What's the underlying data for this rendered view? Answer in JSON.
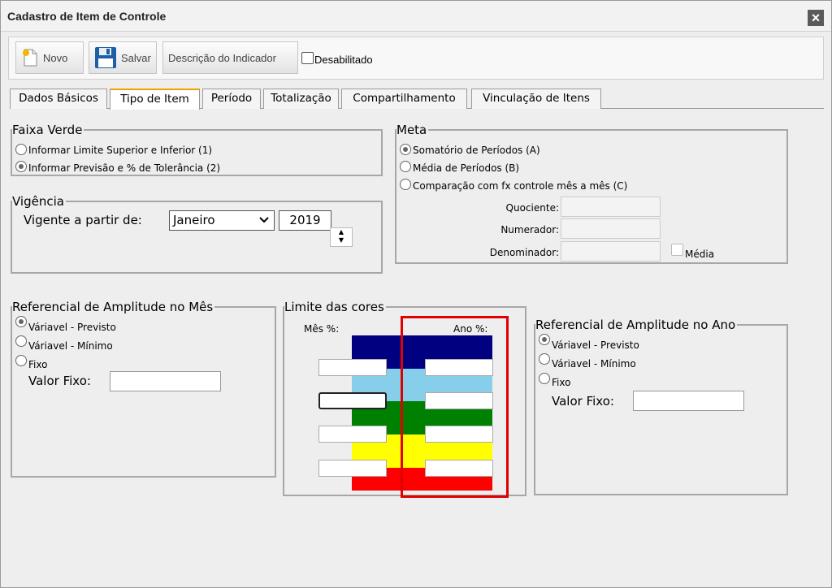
{
  "window": {
    "title": "Cadastro de Item de Controle"
  },
  "toolbar": {
    "novo": "Novo",
    "salvar": "Salvar",
    "descricao": "Descrição do Indicador",
    "desabilitado": "Desabilitado"
  },
  "tabs": [
    {
      "label": "Dados Básicos",
      "active": false
    },
    {
      "label": "Tipo de Item",
      "active": true
    },
    {
      "label": "Período",
      "active": false
    },
    {
      "label": "Totalização",
      "active": false
    },
    {
      "label": "Compartilhamento",
      "active": false
    },
    {
      "label": "Vinculação de Itens",
      "active": false
    }
  ],
  "faixa_verde": {
    "legend": "Faixa Verde",
    "options": [
      {
        "label": "Informar Limite Superior e Inferior (1)",
        "selected": false
      },
      {
        "label": "Informar Previsão e % de Tolerância (2)",
        "selected": true
      }
    ]
  },
  "vigencia": {
    "legend": "Vigência",
    "label": "Vigente a partir de:",
    "month": "Janeiro",
    "year": "2019",
    "spin_up": "▲",
    "spin_down": "▼"
  },
  "meta": {
    "legend": "Meta",
    "options": [
      {
        "label": "Somatório de Períodos (A)",
        "selected": true
      },
      {
        "label": "Média de Períodos (B)",
        "selected": false
      },
      {
        "label": "Comparação com fx controle mês a mês (C)",
        "selected": false
      }
    ],
    "quociente": "Quociente:",
    "numerador": "Numerador:",
    "denominador": "Denominador:",
    "media": "Média"
  },
  "amplitude_mes": {
    "legend": "Referencial de Amplitude no Mês",
    "options": [
      {
        "label": "Váriavel - Previsto",
        "selected": true
      },
      {
        "label": "Váriavel - Mínimo",
        "selected": false
      },
      {
        "label": "Fixo",
        "selected": false
      }
    ],
    "valor_fixo_label": "Valor Fixo:"
  },
  "limite_cores": {
    "legend": "Limite das cores",
    "mes_label": "Mês %:",
    "ano_label": "Ano %:",
    "bands": [
      "#000080",
      "#87ceeb",
      "#008000",
      "#ffff00",
      "#ff0000"
    ]
  },
  "amplitude_ano": {
    "legend": "Referencial de Amplitude no Ano",
    "options": [
      {
        "label": "Váriavel - Previsto",
        "selected": true
      },
      {
        "label": "Váriavel - Mínimo",
        "selected": false
      },
      {
        "label": "Fixo",
        "selected": false
      }
    ],
    "valor_fixo_label": "Valor Fixo:"
  },
  "colors": {
    "highlight": "#e00000",
    "tab_accent": "#f0a000"
  }
}
